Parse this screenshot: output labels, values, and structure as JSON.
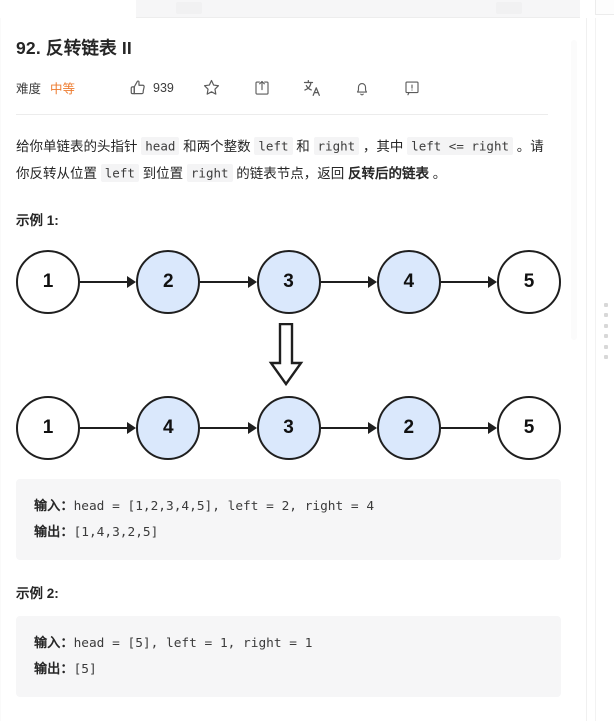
{
  "problem": {
    "title": "92. 反转链表 II",
    "difficulty_label": "难度",
    "difficulty_value": "中等",
    "like_count": "939",
    "accent_color": "#ed7b2f",
    "actions": [
      {
        "name": "like-icon",
        "label": "点赞"
      },
      {
        "name": "star-icon",
        "label": "收藏"
      },
      {
        "name": "share-icon",
        "label": "分享"
      },
      {
        "name": "translate-icon",
        "label": "切换语言"
      },
      {
        "name": "bell-icon",
        "label": "提醒"
      },
      {
        "name": "report-icon",
        "label": "反馈"
      }
    ]
  },
  "description": {
    "seg1": "给你单链表的头指针 ",
    "code1": "head",
    "seg2": " 和两个整数 ",
    "code2": "left",
    "seg3": " 和 ",
    "code3": "right",
    "seg4": " ，其中 ",
    "code4": "left <= right",
    "seg5": " 。请你反转从位置 ",
    "code5": "left",
    "seg6": " 到位置 ",
    "code6": "right",
    "seg7": " 的链表节点，返回 ",
    "bold1": "反转后的链表",
    "seg8": " 。"
  },
  "examples": [
    {
      "heading": "示例 1:",
      "figure": {
        "before": [
          {
            "value": "1",
            "highlighted": false
          },
          {
            "value": "2",
            "highlighted": true
          },
          {
            "value": "3",
            "highlighted": true
          },
          {
            "value": "4",
            "highlighted": true
          },
          {
            "value": "5",
            "highlighted": false
          }
        ],
        "after": [
          {
            "value": "1",
            "highlighted": false
          },
          {
            "value": "4",
            "highlighted": true
          },
          {
            "value": "3",
            "highlighted": true
          },
          {
            "value": "2",
            "highlighted": true
          },
          {
            "value": "5",
            "highlighted": false
          }
        ],
        "node_fill_highlight": "#dae8fc",
        "node_fill_plain": "#ffffff",
        "node_stroke": "#1f1f1f"
      },
      "input_label": "输入：",
      "input_value": "head = [1,2,3,4,5], left = 2, right = 4",
      "output_label": "输出：",
      "output_value": "[1,4,3,2,5]"
    },
    {
      "heading": "示例 2:",
      "input_label": "输入：",
      "input_value": "head = [5], left = 1, right = 1",
      "output_label": "输出：",
      "output_value": "[5]"
    }
  ]
}
